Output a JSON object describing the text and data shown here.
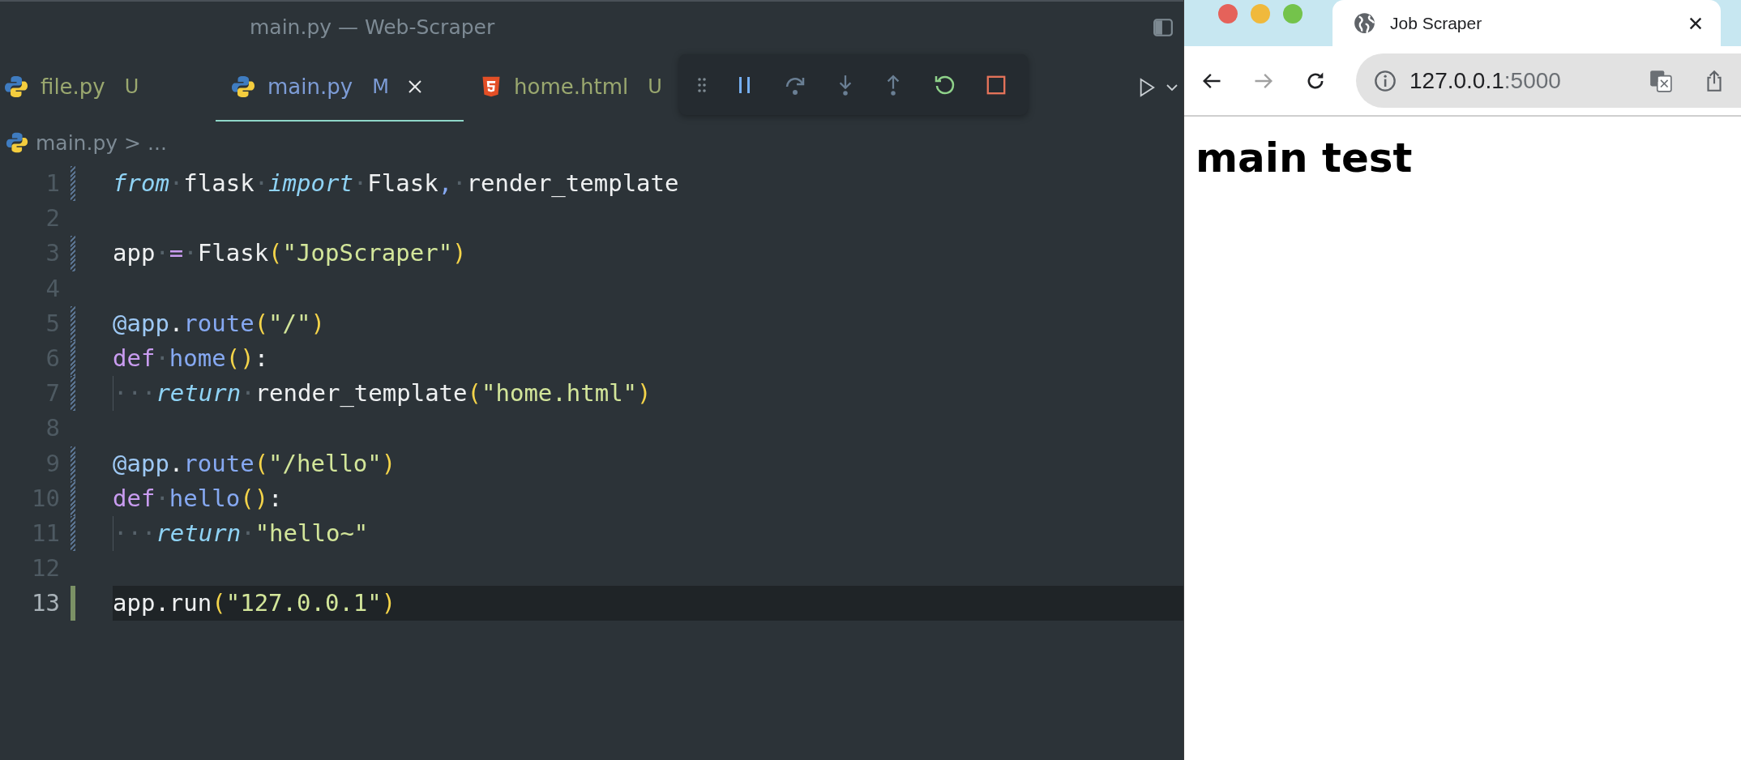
{
  "editor": {
    "title": "main.py — Web-Scraper",
    "tabs": [
      {
        "label": "file.py",
        "badge": "U",
        "kind": "python",
        "color": "#9aa86f",
        "selected": false
      },
      {
        "label": "main.py",
        "badge": "M",
        "kind": "python",
        "color": "#7d9cd6",
        "selected": true
      },
      {
        "label": "home.html",
        "badge": "U",
        "kind": "html",
        "color": "#9aa86f",
        "selected": false
      }
    ],
    "breadcrumb": {
      "file": "main.py",
      "separator": ">",
      "rest": "..."
    },
    "lines": [
      {
        "number": "1",
        "kind": "modified",
        "current": false,
        "indent_guide": false,
        "tokens": [
          {
            "kind": "kw",
            "text": "from"
          },
          {
            "kind": "ws",
            "text": "·"
          },
          {
            "kind": "id",
            "text": "flask"
          },
          {
            "kind": "ws",
            "text": "·"
          },
          {
            "kind": "kw",
            "text": "import"
          },
          {
            "kind": "ws",
            "text": "·"
          },
          {
            "kind": "id",
            "text": "Flask"
          },
          {
            "kind": "comma",
            "text": ","
          },
          {
            "kind": "ws",
            "text": "·"
          },
          {
            "kind": "id",
            "text": "render_template"
          }
        ]
      },
      {
        "number": "2",
        "current": false
      },
      {
        "number": "3",
        "kind": "modified",
        "current": false,
        "indent_guide": false,
        "tokens": [
          {
            "kind": "id",
            "text": "app"
          },
          {
            "kind": "ws",
            "text": "·"
          },
          {
            "kind": "op",
            "text": "="
          },
          {
            "kind": "ws",
            "text": "·"
          },
          {
            "kind": "id",
            "text": "Flask"
          },
          {
            "kind": "paren",
            "text": "("
          },
          {
            "kind": "str",
            "text": "\"JopScraper\""
          },
          {
            "kind": "paren",
            "text": ")"
          }
        ]
      },
      {
        "number": "4",
        "current": false
      },
      {
        "number": "5",
        "kind": "modified",
        "current": false,
        "indent_guide": false,
        "tokens": [
          {
            "kind": "deco",
            "text": "@app"
          },
          {
            "kind": "id",
            "text": "."
          },
          {
            "kind": "fn",
            "text": "route"
          },
          {
            "kind": "paren",
            "text": "("
          },
          {
            "kind": "str",
            "text": "\"/\""
          },
          {
            "kind": "paren",
            "text": ")"
          }
        ]
      },
      {
        "number": "6",
        "kind": "modified",
        "current": false,
        "indent_guide": false,
        "tokens": [
          {
            "kind": "def",
            "text": "def"
          },
          {
            "kind": "ws",
            "text": "·"
          },
          {
            "kind": "fn",
            "text": "home"
          },
          {
            "kind": "paren",
            "text": "()"
          },
          {
            "kind": "id",
            "text": ":"
          }
        ]
      },
      {
        "number": "7",
        "kind": "modified",
        "current": false,
        "indent_guide": true,
        "tokens": [
          {
            "kind": "ws",
            "text": "···"
          },
          {
            "kind": "kw",
            "text": "return"
          },
          {
            "kind": "ws",
            "text": "·"
          },
          {
            "kind": "id",
            "text": "render_template"
          },
          {
            "kind": "paren",
            "text": "("
          },
          {
            "kind": "str",
            "text": "\"home.html\""
          },
          {
            "kind": "paren",
            "text": ")"
          }
        ]
      },
      {
        "number": "8",
        "current": false
      },
      {
        "number": "9",
        "kind": "modified",
        "current": false,
        "indent_guide": false,
        "tokens": [
          {
            "kind": "deco",
            "text": "@app"
          },
          {
            "kind": "id",
            "text": "."
          },
          {
            "kind": "fn",
            "text": "route"
          },
          {
            "kind": "paren",
            "text": "("
          },
          {
            "kind": "str",
            "text": "\"/hello\""
          },
          {
            "kind": "paren",
            "text": ")"
          }
        ]
      },
      {
        "number": "10",
        "kind": "modified",
        "current": false,
        "indent_guide": false,
        "tokens": [
          {
            "kind": "def",
            "text": "def"
          },
          {
            "kind": "ws",
            "text": "·"
          },
          {
            "kind": "fn",
            "text": "hello"
          },
          {
            "kind": "paren",
            "text": "()"
          },
          {
            "kind": "id",
            "text": ":"
          }
        ]
      },
      {
        "number": "11",
        "kind": "modified",
        "current": false,
        "indent_guide": true,
        "tokens": [
          {
            "kind": "ws",
            "text": "···"
          },
          {
            "kind": "kw",
            "text": "return"
          },
          {
            "kind": "ws",
            "text": "·"
          },
          {
            "kind": "str",
            "text": "\"hello~\""
          }
        ]
      },
      {
        "number": "12",
        "current": false
      },
      {
        "number": "13",
        "kind": "added",
        "current": true,
        "indent_guide": false,
        "tokens": [
          {
            "kind": "id",
            "text": "app"
          },
          {
            "kind": "id",
            "text": "."
          },
          {
            "kind": "id",
            "text": "run"
          },
          {
            "kind": "paren",
            "text": "("
          },
          {
            "kind": "str",
            "text": "\"127.0.0.1\""
          },
          {
            "kind": "paren",
            "text": ")"
          }
        ]
      }
    ]
  },
  "browser": {
    "tab": {
      "title": "Job Scraper"
    },
    "back": {
      "disabled": false
    },
    "forward": {
      "disabled": true
    },
    "address": {
      "host": "127.0.0.1",
      "port": ":5000"
    },
    "page": {
      "heading": "main test"
    }
  }
}
